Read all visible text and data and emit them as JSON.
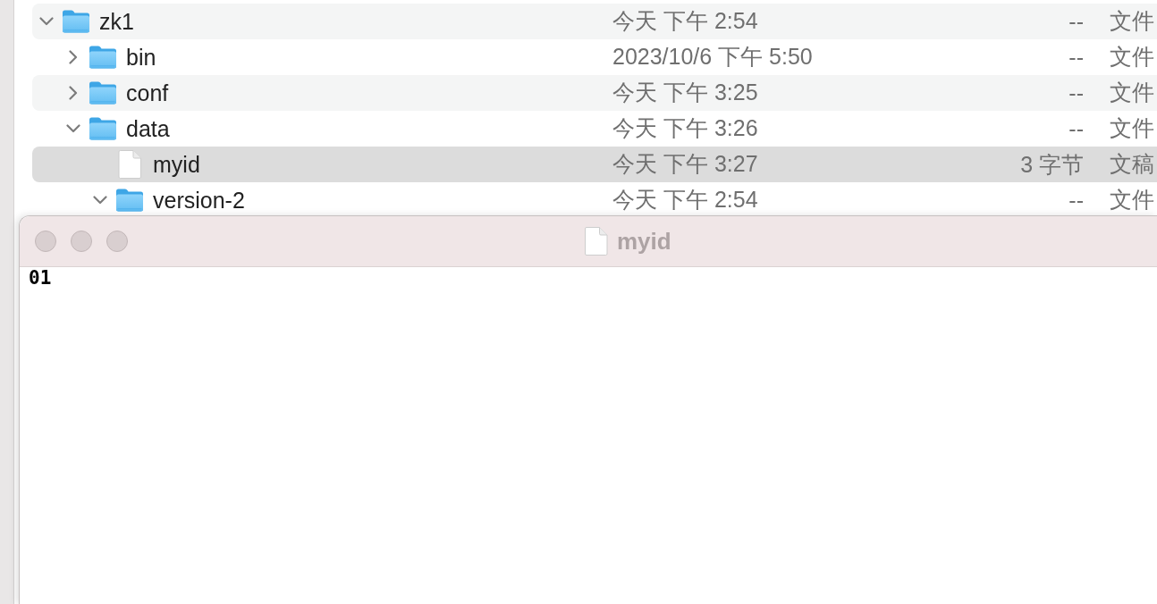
{
  "finder": {
    "rows": [
      {
        "kind": "folder",
        "name": "zk1",
        "column_2": "今天 下午 2:54",
        "column_3": "--",
        "column_4": "文件",
        "expanded": true,
        "selected": false,
        "children": [
          {
            "kind": "folder",
            "name": "bin",
            "column_2": "2023/10/6 下午 5:50",
            "column_3": "--",
            "column_4": "文件",
            "expanded": false,
            "selected": false
          },
          {
            "kind": "folder",
            "name": "conf",
            "column_2": "今天 下午 3:25",
            "column_3": "--",
            "column_4": "文件",
            "expanded": false,
            "selected": false
          },
          {
            "kind": "folder",
            "name": "data",
            "column_2": "今天 下午 3:26",
            "column_3": "--",
            "column_4": "文件",
            "expanded": true,
            "selected": false,
            "children": [
              {
                "kind": "file",
                "name": "myid",
                "column_2": "今天 下午 3:27",
                "column_3": "3 字节",
                "column_4": "文稿",
                "selected": true
              },
              {
                "kind": "folder",
                "name": "version-2",
                "column_2": "今天 下午 2:54",
                "column_3": "--",
                "column_4": "文件",
                "expanded": true,
                "selected": false
              }
            ]
          }
        ]
      }
    ]
  },
  "editor": {
    "title": "myid",
    "text": "01"
  }
}
